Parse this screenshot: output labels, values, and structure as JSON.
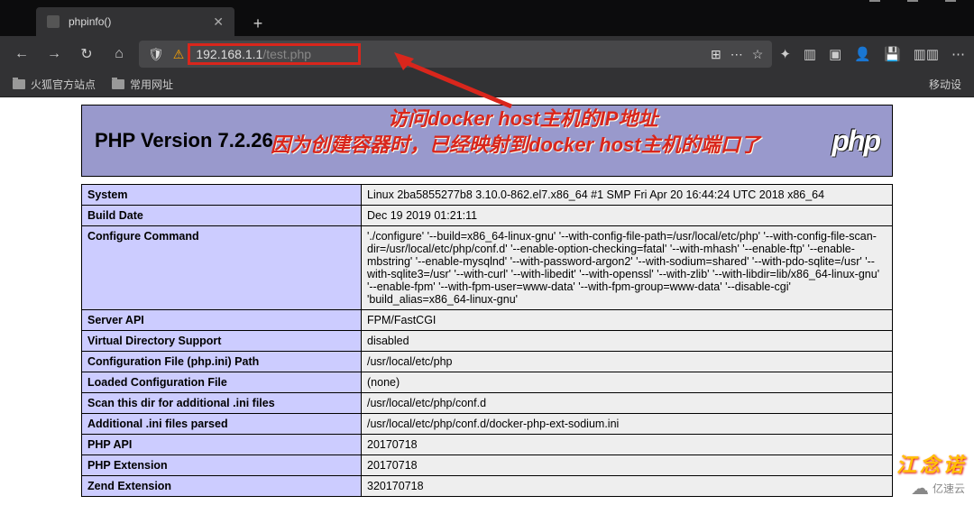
{
  "window": {
    "min": "—",
    "max": "☐",
    "close": "✕"
  },
  "tabs": {
    "active": {
      "title": "phpinfo()",
      "close": "✕"
    },
    "new": "+"
  },
  "nav": {
    "back": "←",
    "forward": "→",
    "reload": "↻",
    "home": "⌂",
    "shield": "🛡",
    "lock": "⚠",
    "url_prefix": "192.168.1.1",
    "url_path": "/test.php",
    "qr": "⊞",
    "dots": "⋯",
    "star": "☆",
    "right": [
      "✦",
      "▥",
      "▣",
      "👤",
      "💾",
      "▥▥",
      "⋯"
    ]
  },
  "bookmarks": {
    "a": "火狐官方站点",
    "b": "常用网址",
    "right": "移动设"
  },
  "php": {
    "version_label": "PHP Version 7.2.26",
    "logo": "php"
  },
  "annotations": {
    "line1": "访问docker host主机的IP地址",
    "line2": "因为创建容器时，已经映射到docker host主机的端口了"
  },
  "rows": [
    {
      "k": "System",
      "v": "Linux 2ba5855277b8 3.10.0-862.el7.x86_64 #1 SMP Fri Apr 20 16:44:24 UTC 2018 x86_64"
    },
    {
      "k": "Build Date",
      "v": "Dec 19 2019 01:21:11"
    },
    {
      "k": "Configure Command",
      "v": "'./configure' '--build=x86_64-linux-gnu' '--with-config-file-path=/usr/local/etc/php' '--with-config-file-scan-dir=/usr/local/etc/php/conf.d' '--enable-option-checking=fatal' '--with-mhash' '--enable-ftp' '--enable-mbstring' '--enable-mysqlnd' '--with-password-argon2' '--with-sodium=shared' '--with-pdo-sqlite=/usr' '--with-sqlite3=/usr' '--with-curl' '--with-libedit' '--with-openssl' '--with-zlib' '--with-libdir=lib/x86_64-linux-gnu' '--enable-fpm' '--with-fpm-user=www-data' '--with-fpm-group=www-data' '--disable-cgi' 'build_alias=x86_64-linux-gnu'"
    },
    {
      "k": "Server API",
      "v": "FPM/FastCGI"
    },
    {
      "k": "Virtual Directory Support",
      "v": "disabled"
    },
    {
      "k": "Configuration File (php.ini) Path",
      "v": "/usr/local/etc/php"
    },
    {
      "k": "Loaded Configuration File",
      "v": "(none)"
    },
    {
      "k": "Scan this dir for additional .ini files",
      "v": "/usr/local/etc/php/conf.d"
    },
    {
      "k": "Additional .ini files parsed",
      "v": "/usr/local/etc/php/conf.d/docker-php-ext-sodium.ini"
    },
    {
      "k": "PHP API",
      "v": "20170718"
    },
    {
      "k": "PHP Extension",
      "v": "20170718"
    },
    {
      "k": "Zend Extension",
      "v": "320170718"
    }
  ],
  "watermark": "江念诺",
  "cloud": "亿速云"
}
